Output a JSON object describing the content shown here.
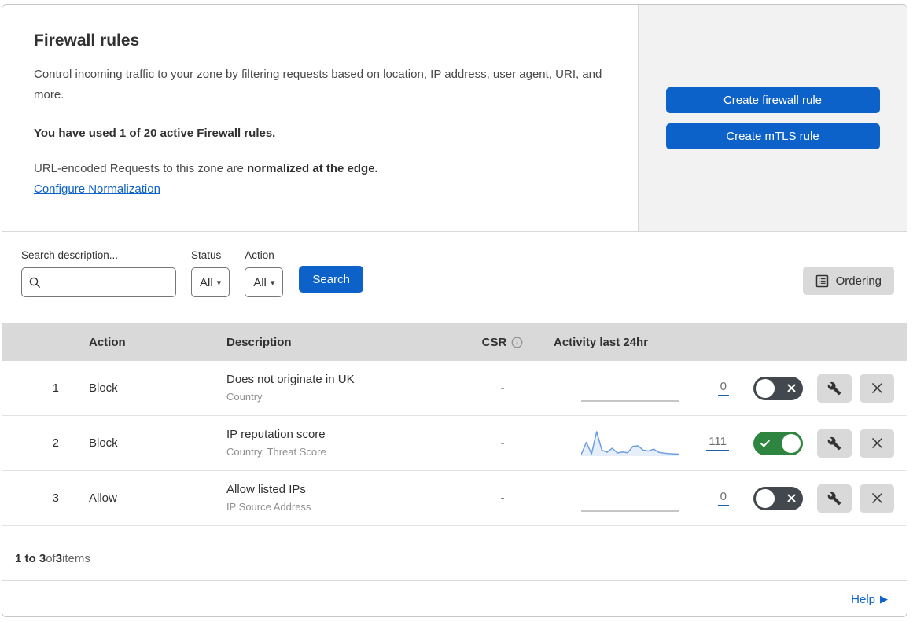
{
  "header": {
    "title": "Firewall rules",
    "description": "Control incoming traffic to your zone by filtering requests based on location, IP address, user agent, URI, and more.",
    "usage_note": "You have used 1 of 20 active Firewall rules.",
    "normalization_prefix": "URL-encoded Requests to this zone are ",
    "normalization_bold": "normalized at the edge.",
    "normalization_link": "Configure Normalization",
    "create_firewall_rule_label": "Create firewall rule",
    "create_mtls_rule_label": "Create mTLS rule"
  },
  "filters": {
    "search_label": "Search description...",
    "search_value": "",
    "status_label": "Status",
    "status_value": "All",
    "action_label": "Action",
    "action_value": "All",
    "search_button_label": "Search",
    "ordering_button_label": "Ordering"
  },
  "table": {
    "columns": {
      "action": "Action",
      "description": "Description",
      "csr": "CSR",
      "activity": "Activity last 24hr"
    },
    "rows": [
      {
        "priority": "1",
        "action": "Block",
        "description": "Does not originate in UK",
        "fields": "Country",
        "csr": "-",
        "activity_count": "0",
        "enabled": false,
        "sparkline": []
      },
      {
        "priority": "2",
        "action": "Block",
        "description": "IP reputation score",
        "fields": "Country, Threat Score",
        "csr": "-",
        "activity_count": "111",
        "enabled": true,
        "sparkline": [
          3,
          55,
          6,
          100,
          22,
          13,
          30,
          10,
          14,
          11,
          38,
          40,
          22,
          18,
          26,
          13,
          9,
          7,
          6,
          5
        ]
      },
      {
        "priority": "3",
        "action": "Allow",
        "description": "Allow listed IPs",
        "fields": "IP Source Address",
        "csr": "-",
        "activity_count": "0",
        "enabled": false,
        "sparkline": []
      }
    ]
  },
  "footer": {
    "range": "1 to 3",
    "of_text": " of ",
    "total": "3",
    "items_text": " items"
  },
  "help": {
    "label": "Help"
  },
  "colors": {
    "primary_blue": "#0d62c9",
    "toggle_on_green": "#2e8540",
    "toggle_off_gray": "#42484d",
    "sparkline_blue": "#6d9ee0",
    "sparkline_flat_gray": "#b3b3b3",
    "panel_gray": "#f2f2f2",
    "table_header_gray": "#d9d9d9"
  }
}
